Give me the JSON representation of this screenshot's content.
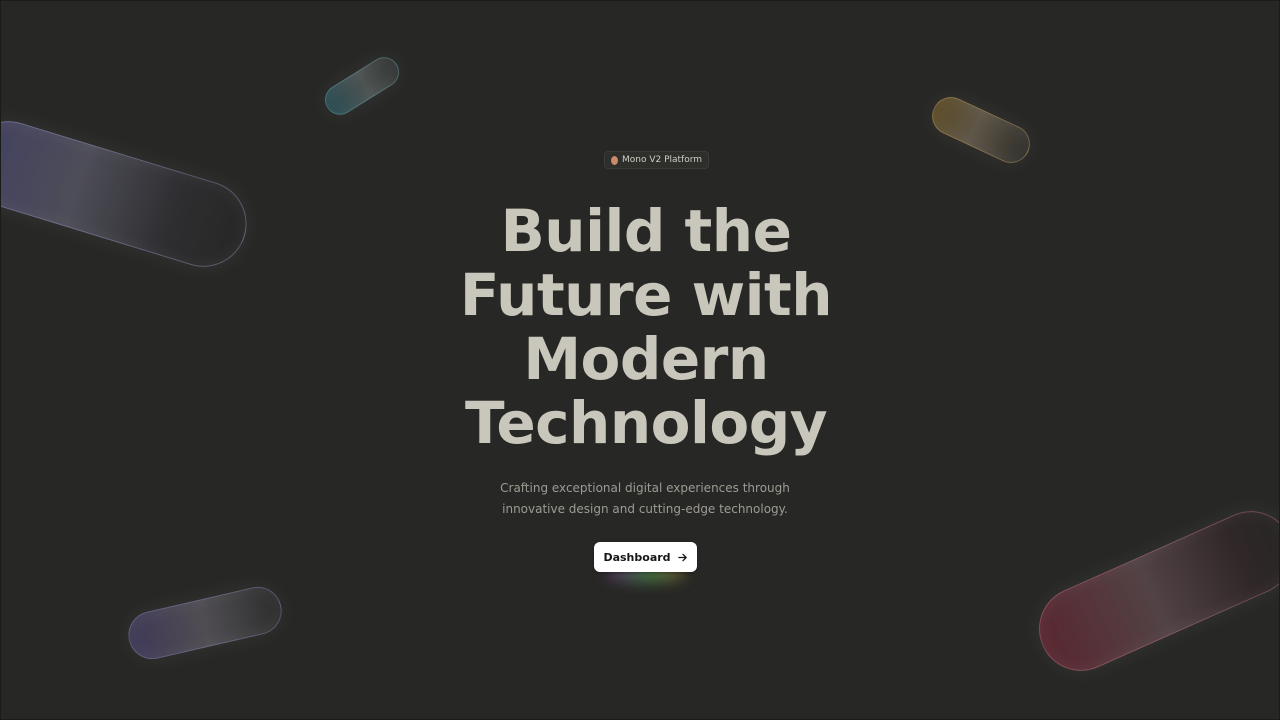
{
  "badge": {
    "label": "Mono V2 Platform"
  },
  "hero": {
    "headline_lines": [
      "Build the",
      "Future with",
      "Modern",
      "Technology"
    ],
    "subtitle_lines": [
      "Crafting exceptional digital experiences through",
      "innovative design and cutting-edge technology."
    ]
  },
  "cta": {
    "label": "Dashboard",
    "icon": "arrow-right-icon"
  },
  "colors": {
    "background": "#272725",
    "headline": "#c9c7bc",
    "subtitle": "#9d9b93",
    "badge_dot": "#c98b6b",
    "button_bg": "#ffffff",
    "button_text": "#161616"
  },
  "decor": {
    "pills": [
      "indigo",
      "teal",
      "amber",
      "violet",
      "rose"
    ]
  }
}
